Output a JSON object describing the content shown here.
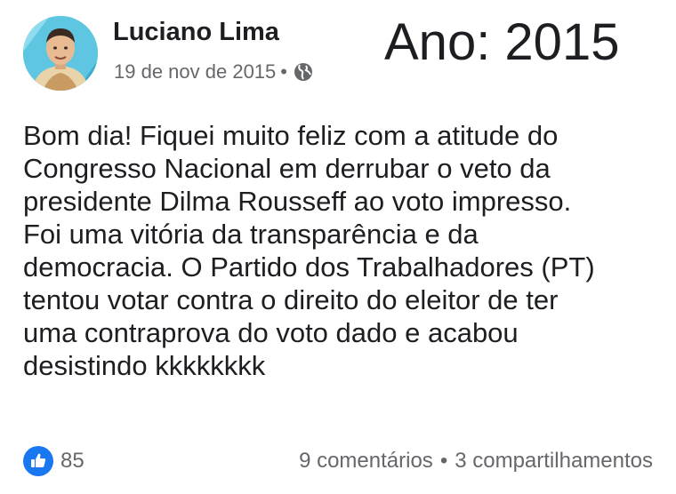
{
  "post": {
    "author": "Luciano Lima",
    "date": "19 de nov de 2015",
    "separator": "•",
    "privacy_icon": "globe-icon",
    "overlay_label": "Ano: 2015",
    "text": "Bom dia! Fiquei muito feliz com a atitude do\nCongresso Nacional em derrubar o veto da\npresidente Dilma Rousseff ao voto impresso.\nFoi uma vitória da transparência e da\ndemocracia. O Partido dos Trabalhadores (PT)\ntentou votar contra o direito do eleitor de ter\numa contraprova do voto dado e acabou\ndesistindo kkkkkkkk"
  },
  "footer": {
    "reaction_icon": "like-icon",
    "reaction_count": "85",
    "comments": "9 comentários",
    "separator": "•",
    "shares": "3 compartilhamentos"
  },
  "colors": {
    "like_blue": "#1a77f2",
    "meta_gray": "#65676b",
    "text": "#1c1e21"
  }
}
